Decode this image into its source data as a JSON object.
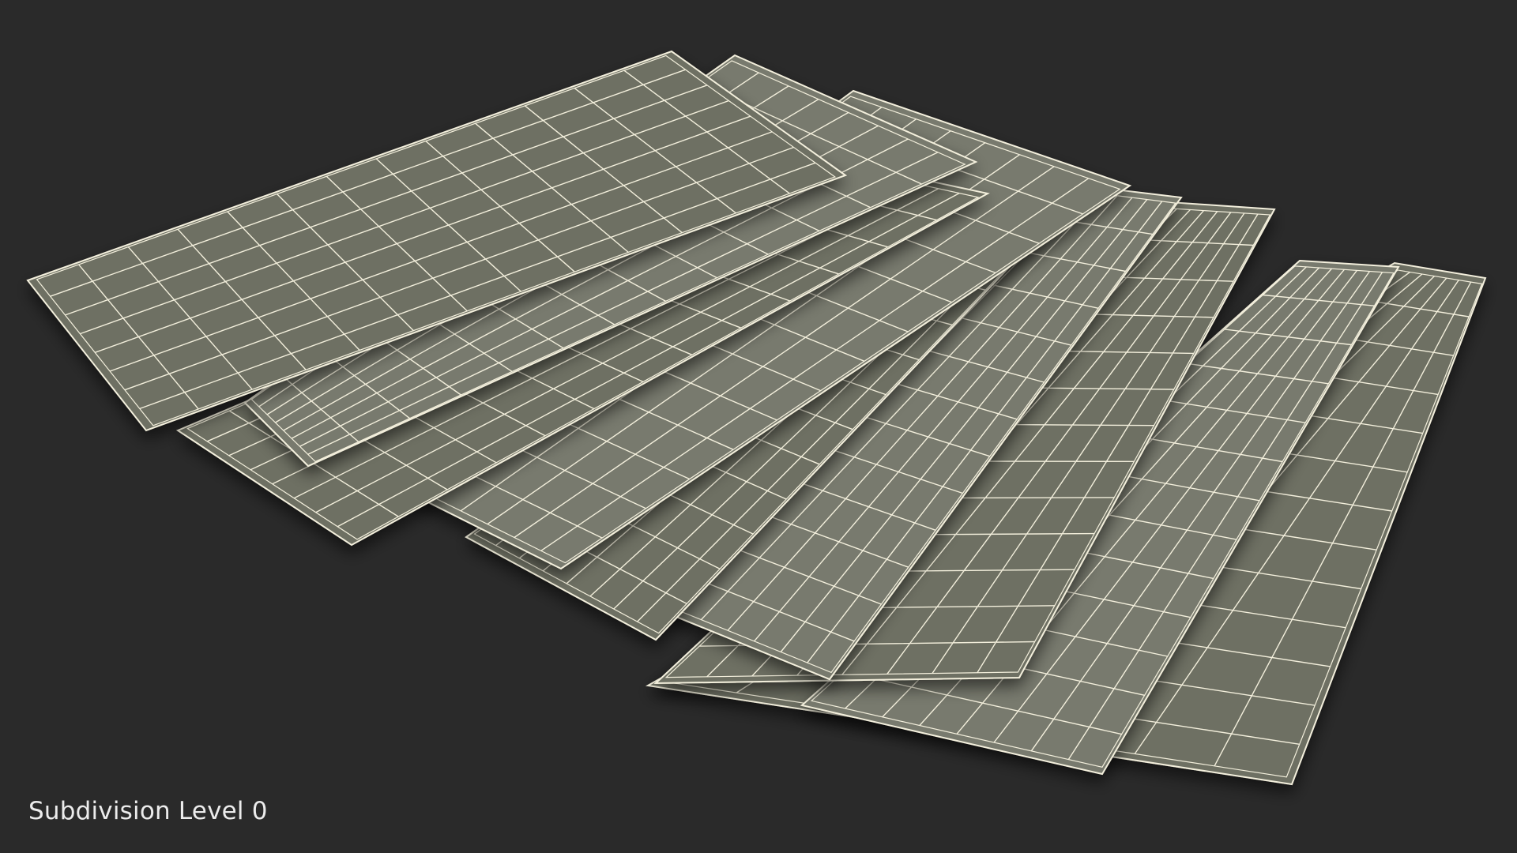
{
  "caption": "Subdivision Level 0",
  "colors": {
    "background": "#2a2a2a",
    "sheet_fill": "#787a6e",
    "sheet_fill_shaded": "#6e7064",
    "wire": "#f3efdc",
    "caption_text": "#ececec"
  },
  "scene": {
    "object": "stack of paper sheets",
    "sheet_count": 9,
    "display": "wireframe on shaded"
  }
}
